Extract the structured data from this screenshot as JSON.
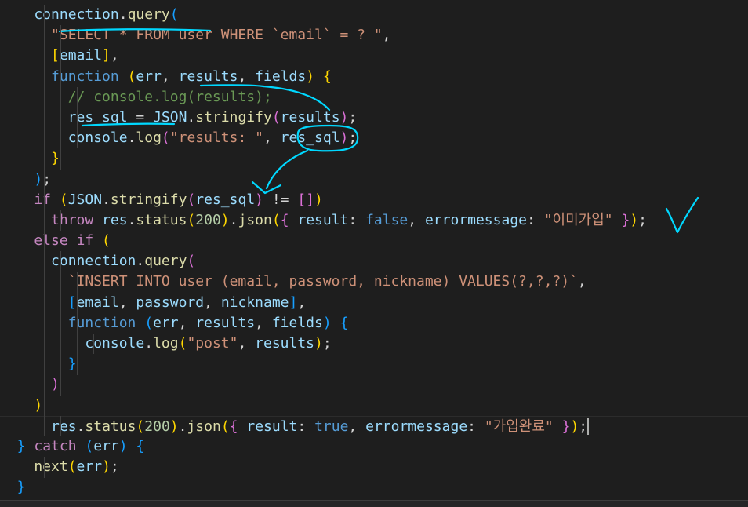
{
  "editor": {
    "language": "javascript",
    "lines": [
      [
        [
          "tk-var",
          "    connection"
        ],
        [
          "tk-op",
          "."
        ],
        [
          "tk-fn",
          "query"
        ],
        [
          "b3",
          "("
        ]
      ],
      [
        [
          "tk-str",
          "      \"SELECT * FROM user WHERE `email` = ? \""
        ],
        [
          "tk-op",
          ","
        ]
      ],
      [
        [
          "b1",
          "      ["
        ],
        [
          "tk-var",
          "email"
        ],
        [
          "b1",
          "]"
        ],
        [
          "tk-op",
          ","
        ]
      ],
      [
        [
          "tk-sk",
          "      function "
        ],
        [
          "b1",
          "("
        ],
        [
          "tk-var",
          "err"
        ],
        [
          "tk-op",
          ", "
        ],
        [
          "tk-var",
          "results"
        ],
        [
          "tk-op",
          ", "
        ],
        [
          "tk-var",
          "fields"
        ],
        [
          "b1",
          ")"
        ],
        [
          "tk-op",
          " "
        ],
        [
          "b1",
          "{"
        ]
      ],
      [
        [
          "tk-com",
          "        // console.log(results);"
        ]
      ],
      [
        [
          "tk-var",
          "        res_sql"
        ],
        [
          "tk-op",
          " = "
        ],
        [
          "tk-var",
          "JSON"
        ],
        [
          "tk-op",
          "."
        ],
        [
          "tk-fn",
          "stringify"
        ],
        [
          "b2",
          "("
        ],
        [
          "tk-var",
          "results"
        ],
        [
          "b2",
          ")"
        ],
        [
          "tk-op",
          ";"
        ]
      ],
      [
        [
          "tk-var",
          "        console"
        ],
        [
          "tk-op",
          "."
        ],
        [
          "tk-fn",
          "log"
        ],
        [
          "b2",
          "("
        ],
        [
          "tk-str",
          "\"results: \""
        ],
        [
          "tk-op",
          ", "
        ],
        [
          "tk-var",
          "res_sql"
        ],
        [
          "b2",
          ")"
        ],
        [
          "tk-op",
          ";"
        ]
      ],
      [
        [
          "b1",
          "      }"
        ]
      ],
      [
        [
          "b3",
          "    )"
        ],
        [
          "tk-op",
          ";"
        ]
      ],
      [
        [
          "tk-kw",
          "    if "
        ],
        [
          "b1",
          "("
        ],
        [
          "tk-var",
          "JSON"
        ],
        [
          "tk-op",
          "."
        ],
        [
          "tk-fn",
          "stringify"
        ],
        [
          "b2",
          "("
        ],
        [
          "tk-var",
          "res_sql"
        ],
        [
          "b2",
          ")"
        ],
        [
          "tk-op",
          " != "
        ],
        [
          "b2",
          "[]"
        ],
        [
          "b1",
          ")"
        ]
      ],
      [
        [
          "tk-kw",
          "      throw "
        ],
        [
          "tk-var",
          "res"
        ],
        [
          "tk-op",
          "."
        ],
        [
          "tk-fn",
          "status"
        ],
        [
          "b1",
          "("
        ],
        [
          "tk-num",
          "200"
        ],
        [
          "b1",
          ")"
        ],
        [
          "tk-op",
          "."
        ],
        [
          "tk-fn",
          "json"
        ],
        [
          "b1",
          "("
        ],
        [
          "b2",
          "{"
        ],
        [
          "tk-var",
          " result"
        ],
        [
          "tk-op",
          ": "
        ],
        [
          "tk-sk",
          "false"
        ],
        [
          "tk-op",
          ", "
        ],
        [
          "tk-var",
          "errormessage"
        ],
        [
          "tk-op",
          ": "
        ],
        [
          "tk-str",
          "\"이미가입\""
        ],
        [
          "tk-op",
          " "
        ],
        [
          "b2",
          "}"
        ],
        [
          "b1",
          ")"
        ],
        [
          "tk-op",
          ";"
        ]
      ],
      [
        [
          "tk-kw",
          "    else if "
        ],
        [
          "b1",
          "("
        ]
      ],
      [
        [
          "tk-var",
          "      connection"
        ],
        [
          "tk-op",
          "."
        ],
        [
          "tk-fn",
          "query"
        ],
        [
          "b2",
          "("
        ]
      ],
      [
        [
          "tk-str",
          "        `INSERT INTO user (email, password, nickname) VALUES(?,?,?)`"
        ],
        [
          "tk-op",
          ","
        ]
      ],
      [
        [
          "b3",
          "        ["
        ],
        [
          "tk-var",
          "email"
        ],
        [
          "tk-op",
          ", "
        ],
        [
          "tk-var",
          "password"
        ],
        [
          "tk-op",
          ", "
        ],
        [
          "tk-var",
          "nickname"
        ],
        [
          "b3",
          "]"
        ],
        [
          "tk-op",
          ","
        ]
      ],
      [
        [
          "tk-sk",
          "        function "
        ],
        [
          "b3",
          "("
        ],
        [
          "tk-var",
          "err"
        ],
        [
          "tk-op",
          ", "
        ],
        [
          "tk-var",
          "results"
        ],
        [
          "tk-op",
          ", "
        ],
        [
          "tk-var",
          "fields"
        ],
        [
          "b3",
          ")"
        ],
        [
          "tk-op",
          " "
        ],
        [
          "b3",
          "{"
        ]
      ],
      [
        [
          "tk-var",
          "          console"
        ],
        [
          "tk-op",
          "."
        ],
        [
          "tk-fn",
          "log"
        ],
        [
          "b1",
          "("
        ],
        [
          "tk-str",
          "\"post\""
        ],
        [
          "tk-op",
          ", "
        ],
        [
          "tk-var",
          "results"
        ],
        [
          "b1",
          ")"
        ],
        [
          "tk-op",
          ";"
        ]
      ],
      [
        [
          "b3",
          "        }"
        ]
      ],
      [
        [
          "b2",
          "      )"
        ]
      ],
      [
        [
          "b1",
          "    )"
        ]
      ],
      [
        [
          "tk-var",
          "      res"
        ],
        [
          "tk-op",
          "."
        ],
        [
          "tk-fn",
          "status"
        ],
        [
          "b1",
          "("
        ],
        [
          "tk-num",
          "200"
        ],
        [
          "b1",
          ")"
        ],
        [
          "tk-op",
          "."
        ],
        [
          "tk-fn",
          "json"
        ],
        [
          "b1",
          "("
        ],
        [
          "b2",
          "{"
        ],
        [
          "tk-var",
          " result"
        ],
        [
          "tk-op",
          ": "
        ],
        [
          "tk-sk",
          "true"
        ],
        [
          "tk-op",
          ", "
        ],
        [
          "tk-var",
          "errormessage"
        ],
        [
          "tk-op",
          ": "
        ],
        [
          "tk-str",
          "\"가입완료\""
        ],
        [
          "tk-op",
          " "
        ],
        [
          "b2",
          "}"
        ],
        [
          "b1",
          ")"
        ],
        [
          "tk-op",
          ";"
        ]
      ],
      [
        [
          "b3",
          "  }"
        ],
        [
          "tk-kw",
          " catch "
        ],
        [
          "b3",
          "("
        ],
        [
          "tk-var",
          "err"
        ],
        [
          "b3",
          ")"
        ],
        [
          "tk-op",
          " "
        ],
        [
          "b3",
          "{"
        ]
      ],
      [
        [
          "tk-fn",
          "    next"
        ],
        [
          "b1",
          "("
        ],
        [
          "tk-var",
          "err"
        ],
        [
          "b1",
          ")"
        ],
        [
          "tk-op",
          ";"
        ]
      ],
      [
        [
          "b3",
          "  }"
        ]
      ]
    ]
  },
  "colors": {
    "background": "#1e1e1e",
    "annotation_ink": "#00d8ff"
  }
}
